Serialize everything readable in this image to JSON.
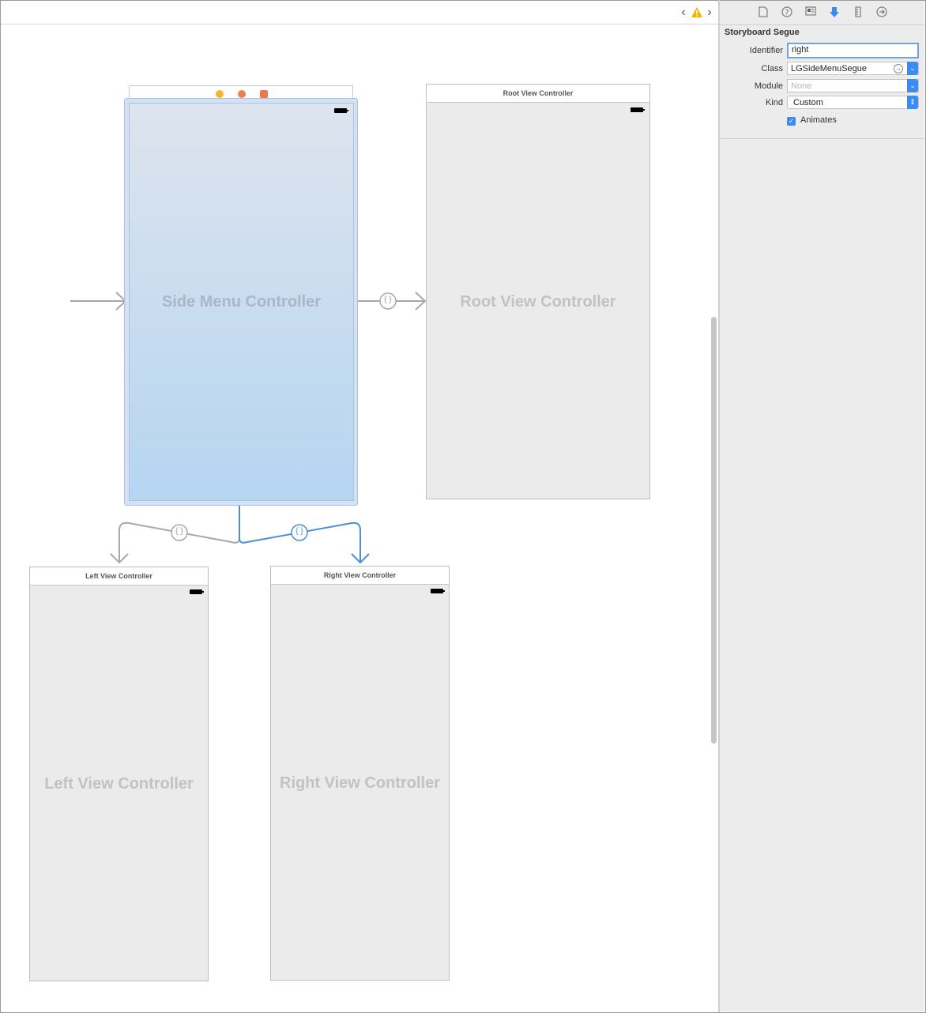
{
  "inspector": {
    "section_title": "Storyboard Segue",
    "identifier_label": "Identifier",
    "identifier_value": "right",
    "class_label": "Class",
    "class_value": "LGSideMenuSegue",
    "module_label": "Module",
    "module_placeholder": "None",
    "kind_label": "Kind",
    "kind_value": "Custom",
    "animates_label": "Animates",
    "animates_checked": true
  },
  "canvas": {
    "side_menu": {
      "name": "Side Menu Controller"
    },
    "root": {
      "title": "Root View Controller",
      "name": "Root View Controller"
    },
    "left": {
      "title": "Left View Controller",
      "name": "Left View Controller"
    },
    "right": {
      "title": "Right View Controller",
      "name": "Right View Controller"
    },
    "segue_badge": "{ }"
  },
  "colors": {
    "selection_blue": "#4a90d9",
    "segue_gray": "#a8a8a8",
    "warning_yellow": "#f5b400"
  },
  "icons": [
    "chevron-left-icon",
    "warning-icon",
    "chevron-right-icon",
    "file-inspector-icon",
    "quick-help-icon",
    "identity-inspector-icon",
    "attributes-inspector-icon",
    "size-inspector-icon",
    "connections-inspector-icon"
  ]
}
